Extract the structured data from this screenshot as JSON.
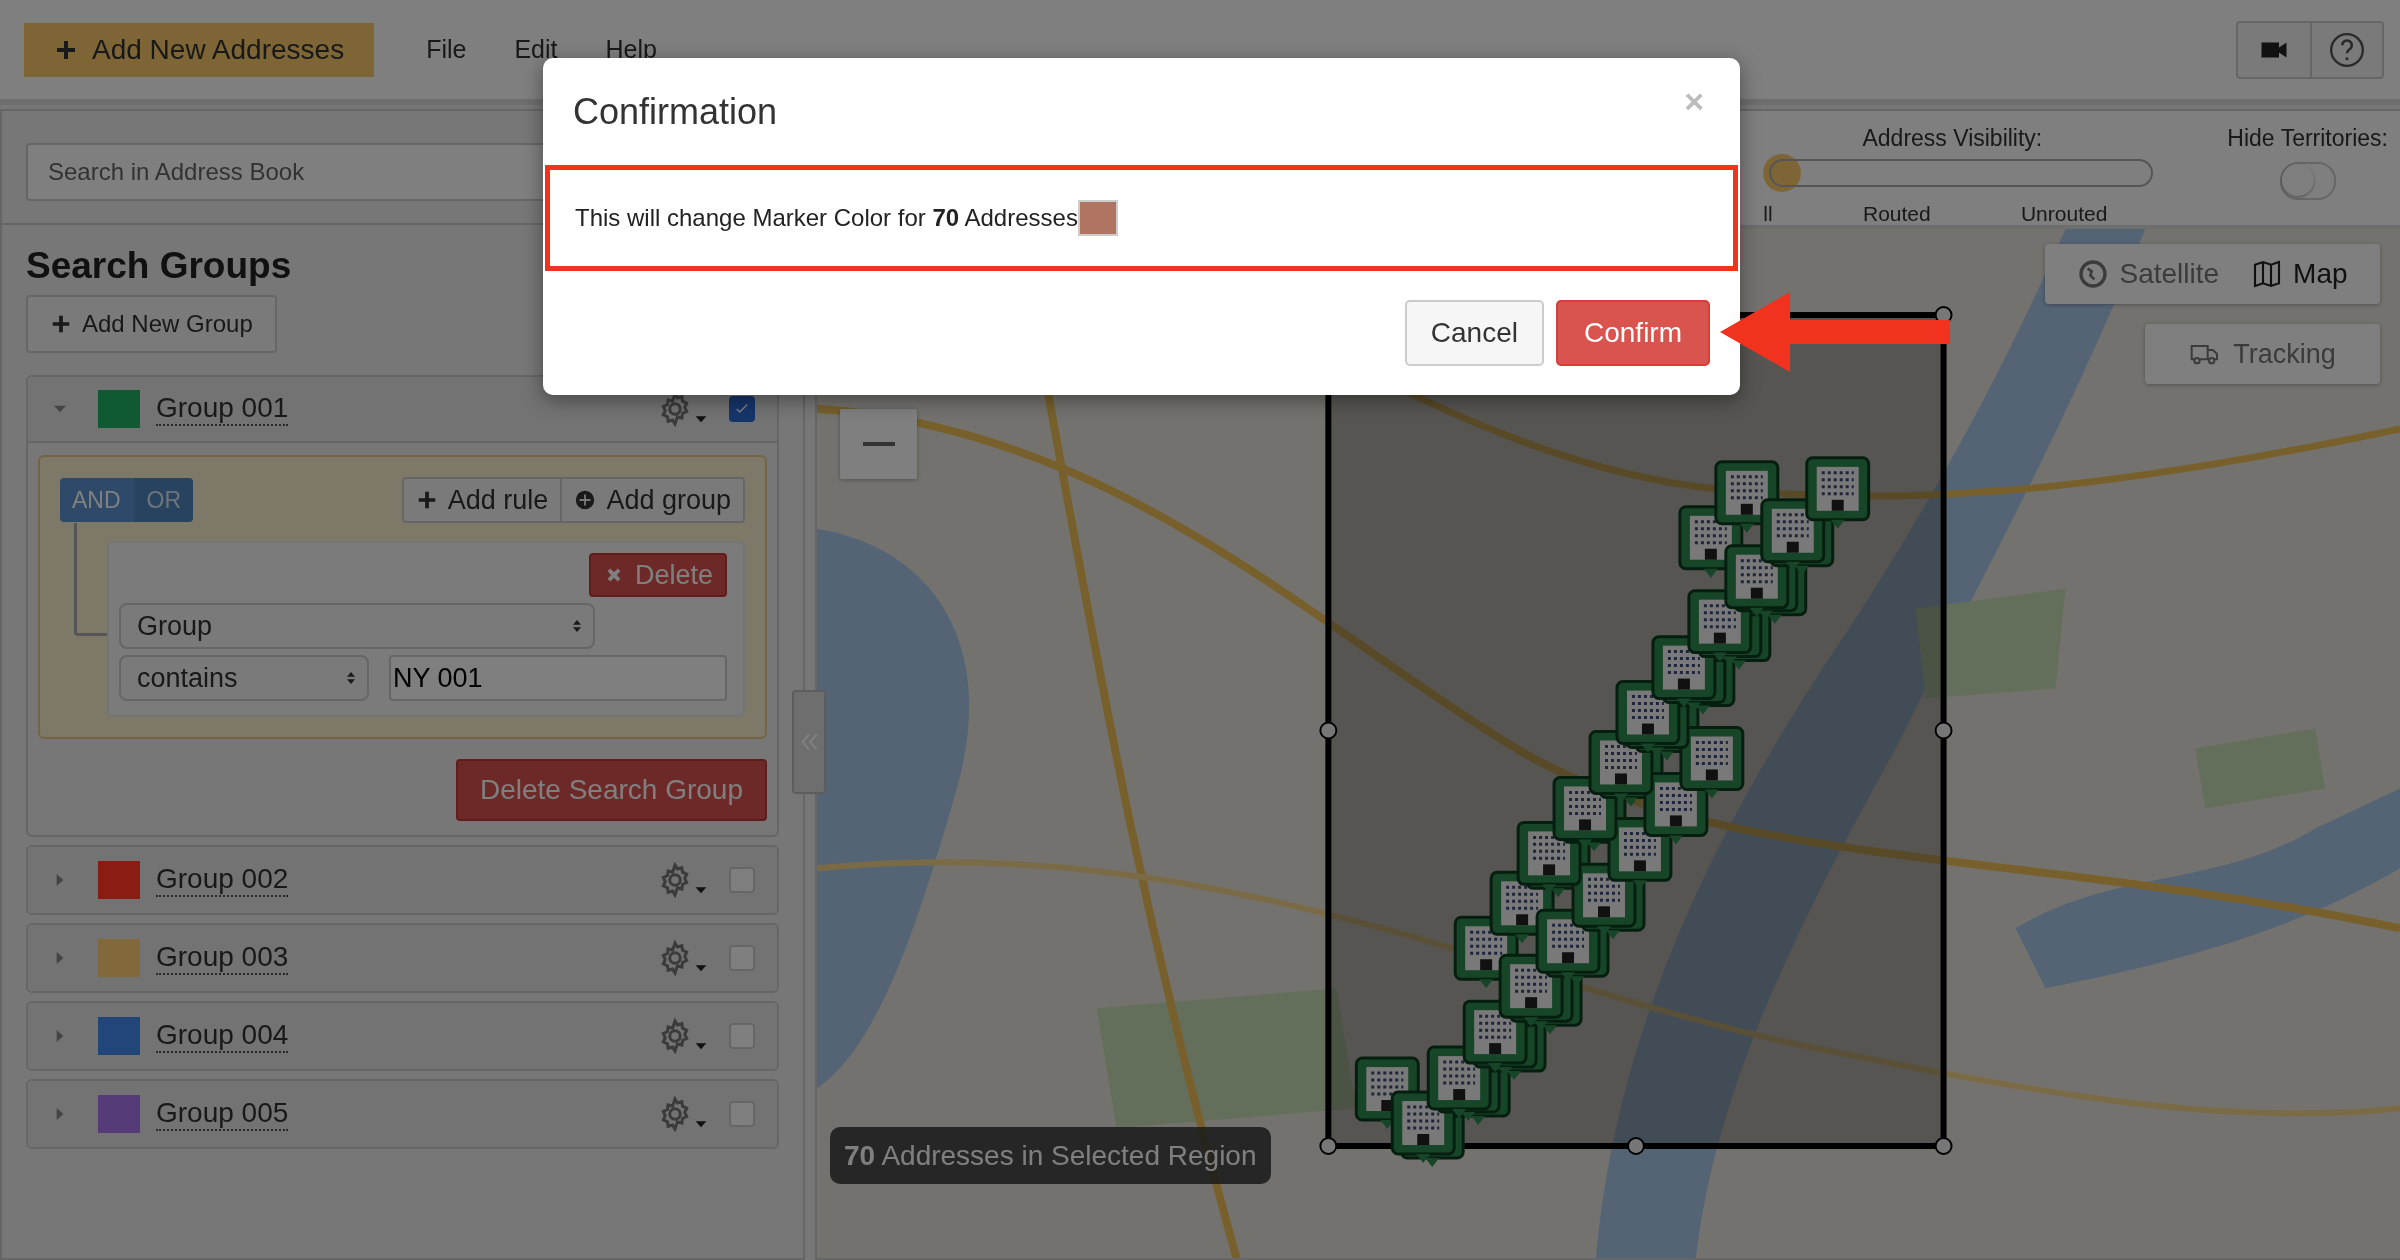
{
  "top_bar": {
    "add_button": "Add New Addresses",
    "menu": [
      "File",
      "Edit",
      "Help"
    ]
  },
  "search": {
    "placeholder": "Search in Address Book"
  },
  "search_groups": {
    "title": "Search Groups",
    "add_button": "Add New Group",
    "groups": [
      {
        "name": "Group 001",
        "color": "#0f5a32",
        "expanded": true,
        "checked": true,
        "query": {
          "conjunctions": [
            {
              "label": "AND",
              "selected": true
            },
            {
              "label": "OR",
              "selected": false
            }
          ],
          "add_rule": "Add rule",
          "add_group": "Add group",
          "delete_rule": "Delete",
          "field": "Group",
          "operator": "contains",
          "value": "NY 001",
          "delete_group": "Delete Search Group"
        }
      },
      {
        "name": "Group 002",
        "color": "#8a1c14",
        "expanded": false,
        "checked": false
      },
      {
        "name": "Group 003",
        "color": "#82693c",
        "expanded": false,
        "checked": false
      },
      {
        "name": "Group 004",
        "color": "#23467a",
        "expanded": false,
        "checked": false
      },
      {
        "name": "Group 005",
        "color": "#553c78",
        "expanded": false,
        "checked": false
      }
    ]
  },
  "map_toolbar": {
    "visibility_label": "Address Visibility:",
    "visibility": {
      "level": 0
    },
    "visibility_options": [
      "ll",
      "Routed",
      "Unrouted"
    ],
    "territories_label": "Hide Territories:",
    "hide_territories": {
      "on": false
    }
  },
  "map": {
    "kind": "picture",
    "map_types": [
      {
        "label": "Satellite",
        "selected": false
      },
      {
        "label": "Map",
        "selected": true
      }
    ],
    "tracking": "Tracking",
    "selection_label": "**70** Addresses in Selected Region"
  },
  "modal": {
    "title": "Confirmation",
    "close": "×",
    "message": "This will change Marker Color for **70** Addresses",
    "swatch": {
      "color": "#b07463"
    },
    "buttons": [
      {
        "label": "Cancel",
        "kind": "default"
      },
      {
        "label": "Confirm",
        "kind": "primary"
      }
    ]
  }
}
